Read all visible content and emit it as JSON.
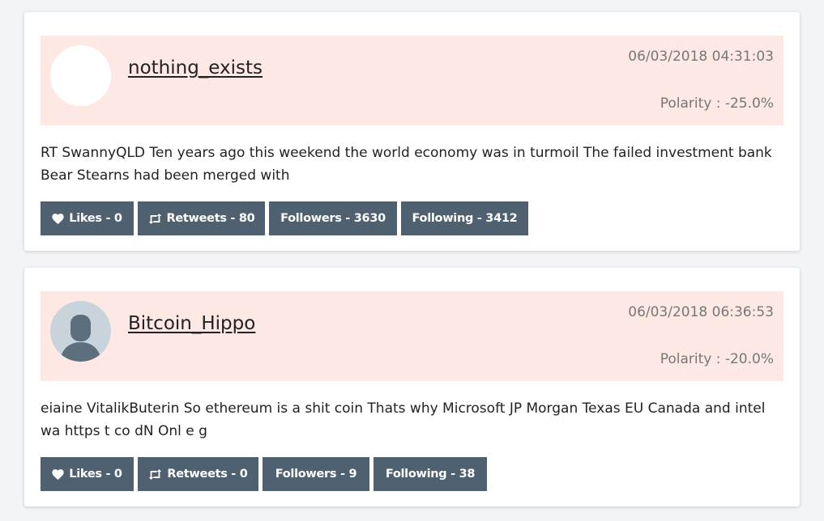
{
  "tweets": [
    {
      "username": "nothing_exists",
      "timestamp": "06/03/2018 04:31:03",
      "polarity": "Polarity : -25.0%",
      "text": "RT SwannyQLD Ten years ago this weekend the world economy was in turmoil The failed investment bank Bear Stearns had been merged with",
      "avatar": "blank-avatar",
      "buttons": {
        "likes": "Likes - 0",
        "retweets": "Retweets - 80",
        "followers": "Followers - 3630",
        "following": "Following - 3412"
      }
    },
    {
      "username": "Bitcoin_Hippo",
      "timestamp": "06/03/2018 06:36:53",
      "polarity": "Polarity : -20.0%",
      "text": "eiaine VitalikButerin So ethereum is a shit coin Thats why Microsoft JP Morgan Texas EU Canada and intel wa https t co dN Onl e g",
      "avatar": "default-user-silhouette",
      "buttons": {
        "likes": "Likes - 0",
        "retweets": "Retweets - 0",
        "followers": "Followers - 9",
        "following": "Following - 38"
      }
    }
  ],
  "icons": {
    "likes": "heart-icon",
    "retweets": "retweet-icon"
  },
  "colors": {
    "header_bg": "#fde8e3",
    "button_bg": "#4f6170",
    "button_text": "#ffffff"
  }
}
